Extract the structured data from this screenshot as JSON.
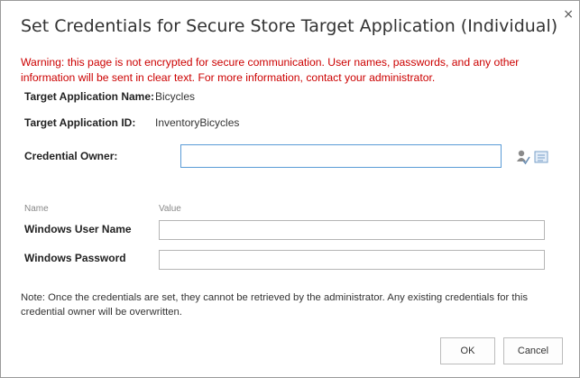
{
  "dialog": {
    "title": "Set Credentials for Secure Store Target Application (Individual)",
    "close_symbol": "×"
  },
  "warning": "Warning: this page is not encrypted for secure communication. User names, passwords, and any other information will be sent in clear text. For more information, contact your administrator.",
  "app_info": {
    "name_label": "Target Application Name:",
    "name_value": "Bicycles",
    "id_label": "Target Application ID:",
    "id_value": "InventoryBicycles"
  },
  "owner": {
    "label": "Credential Owner:",
    "value": "",
    "icons": [
      "check-names-icon",
      "browse-address-book-icon"
    ]
  },
  "columns": {
    "name": "Name",
    "value": "Value"
  },
  "fields": [
    {
      "label": "Windows User Name",
      "value": ""
    },
    {
      "label": "Windows Password",
      "value": ""
    }
  ],
  "note": "Note: Once the credentials are set, they cannot be retrieved by the administrator. Any existing credentials for this credential owner will be overwritten.",
  "buttons": {
    "ok": "OK",
    "cancel": "Cancel"
  },
  "colors": {
    "warning_text": "#cc0000",
    "input_focus_border": "#5a9bd6"
  }
}
